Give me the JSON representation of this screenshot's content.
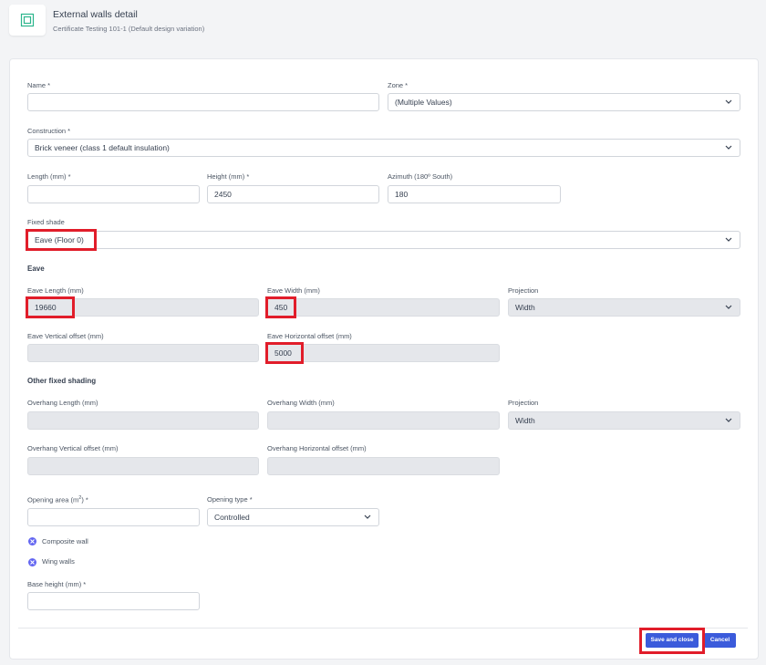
{
  "header": {
    "title": "External walls detail",
    "subtitle": "Certificate Testing 101-1 (Default design variation)"
  },
  "form": {
    "name": {
      "label": "Name *",
      "value": ""
    },
    "zone": {
      "label": "Zone *",
      "value": "(Multiple Values)"
    },
    "construction": {
      "label": "Construction *",
      "value": "Brick veneer (class 1 default insulation)"
    },
    "length": {
      "label": "Length (mm) *",
      "value": ""
    },
    "height": {
      "label": "Height (mm) *",
      "value": "2450"
    },
    "azimuth": {
      "label": "Azimuth (180º South)",
      "value": "180"
    },
    "fixed_shade": {
      "label": "Fixed shade",
      "value": "Eave (Floor 0)"
    },
    "eave": {
      "section": "Eave",
      "length": {
        "label": "Eave Length (mm)",
        "value": "19660"
      },
      "width": {
        "label": "Eave Width (mm)",
        "value": "450"
      },
      "projection": {
        "label": "Projection",
        "value": "Width"
      },
      "vertical_offset": {
        "label": "Eave Vertical offset (mm)",
        "value": ""
      },
      "horizontal_offset": {
        "label": "Eave Horizontal offset (mm)",
        "value": "5000"
      }
    },
    "other_shading": {
      "section": "Other fixed shading",
      "overhang_length": {
        "label": "Overhang Length (mm)",
        "value": ""
      },
      "overhang_width": {
        "label": "Overhang Width (mm)",
        "value": ""
      },
      "projection": {
        "label": "Projection",
        "value": "Width"
      },
      "vertical_offset": {
        "label": "Overhang Vertical offset (mm)",
        "value": ""
      },
      "horizontal_offset": {
        "label": "Overhang Horizontal offset (mm)",
        "value": ""
      }
    },
    "opening_area": {
      "label_prefix": "Opening area (m",
      "label_sup": "2",
      "label_suffix": ") *",
      "value": ""
    },
    "opening_type": {
      "label": "Opening type *",
      "value": "Controlled"
    },
    "composite_wall": "Composite wall",
    "wing_walls": "Wing walls",
    "base_height": {
      "label": "Base height (mm) *",
      "value": ""
    }
  },
  "actions": {
    "save": "Save and close",
    "cancel": "Cancel"
  },
  "colors": {
    "primary": "#3b5bdb",
    "highlight": "#e11d2a",
    "icon": "#6366f1"
  }
}
